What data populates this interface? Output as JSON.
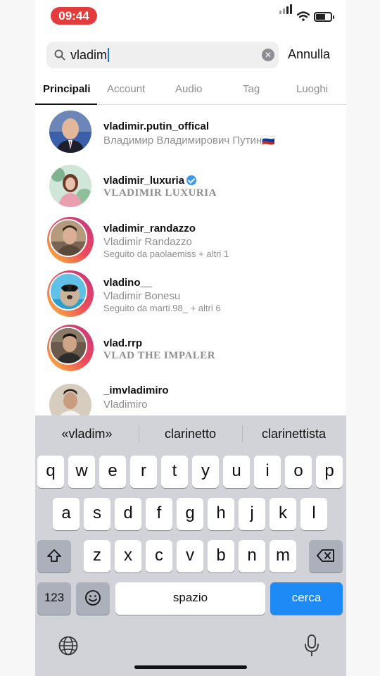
{
  "status": {
    "time": "09:44"
  },
  "search": {
    "value": "vladim",
    "cancel": "Annulla"
  },
  "tabs": [
    "Principali",
    "Account",
    "Audio",
    "Tag",
    "Luoghi"
  ],
  "results": [
    {
      "username": "vladimir.putin_offical",
      "fullname": "Владимир Владимирович Путин🇷🇺",
      "meta": ""
    },
    {
      "username": "vladimir_luxuria",
      "fullname": "VLADIMIR LUXURIA",
      "meta": ""
    },
    {
      "username": "vladimir_randazzo",
      "fullname": "Vladimir Randazzo",
      "meta": "Seguito da paolaemiss + altri 1"
    },
    {
      "username": "vladino__",
      "fullname": "Vladimir Bonesu",
      "meta": "Seguito da marti.98_ + altri 6"
    },
    {
      "username": "vlad.rrp",
      "fullname": "VLAD THE IMPALER",
      "meta": ""
    },
    {
      "username": "_imvladimiro",
      "fullname": "Vladimiro",
      "meta": ""
    }
  ],
  "keyboard": {
    "suggestions": [
      "«vladim»",
      "clarinetto",
      "clarinettista"
    ],
    "row1": [
      "q",
      "w",
      "e",
      "r",
      "t",
      "y",
      "u",
      "i",
      "o",
      "p"
    ],
    "row2": [
      "a",
      "s",
      "d",
      "f",
      "g",
      "h",
      "j",
      "k",
      "l"
    ],
    "row3": [
      "z",
      "x",
      "c",
      "v",
      "b",
      "n",
      "m"
    ],
    "numbers": "123",
    "space": "spazio",
    "return": "cerca"
  },
  "colors": {
    "time_pill": "#e43c3c",
    "verified": "#3897f0",
    "return_key": "#1d8af5"
  }
}
